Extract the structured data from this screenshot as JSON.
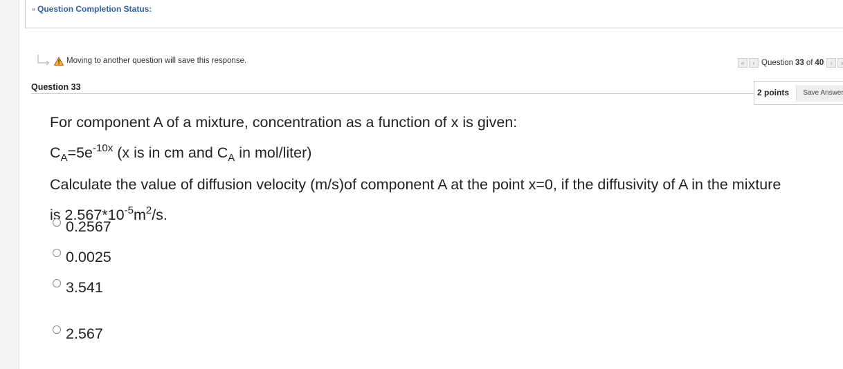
{
  "status": {
    "label": "Question Completion Status:"
  },
  "warning": {
    "text": "Moving to another question will save this response."
  },
  "navigation": {
    "prefix": "Question",
    "current": "33",
    "separator": "of",
    "total": "40"
  },
  "question": {
    "title": "Question 33",
    "points": "2 points",
    "save_label": "Save Answer",
    "line1": "For component A of a mixture, concentration as a function of x is given:",
    "line2": {
      "c1": "C",
      "sub1": "A",
      "eq": "=5e",
      "sup1": "-10x",
      "mid": " (x is in cm and C",
      "sub2": "A",
      "end": " in mol/liter)"
    },
    "line3": "Calculate the value of diffusion velocity (m/s)of component A at the point x=0, if the diffusivity of A in the mixture",
    "line4": {
      "start": "is 2.567*10",
      "sup1": "-5",
      "mid": "m",
      "sup2": "2",
      "end": "/s."
    }
  },
  "options": [
    {
      "label": "0.2567"
    },
    {
      "label": "0.0025"
    },
    {
      "label": "3.541"
    },
    {
      "label": "2.567"
    }
  ],
  "colors": {
    "link": "#2b63a8",
    "warning": "#e8a317"
  }
}
